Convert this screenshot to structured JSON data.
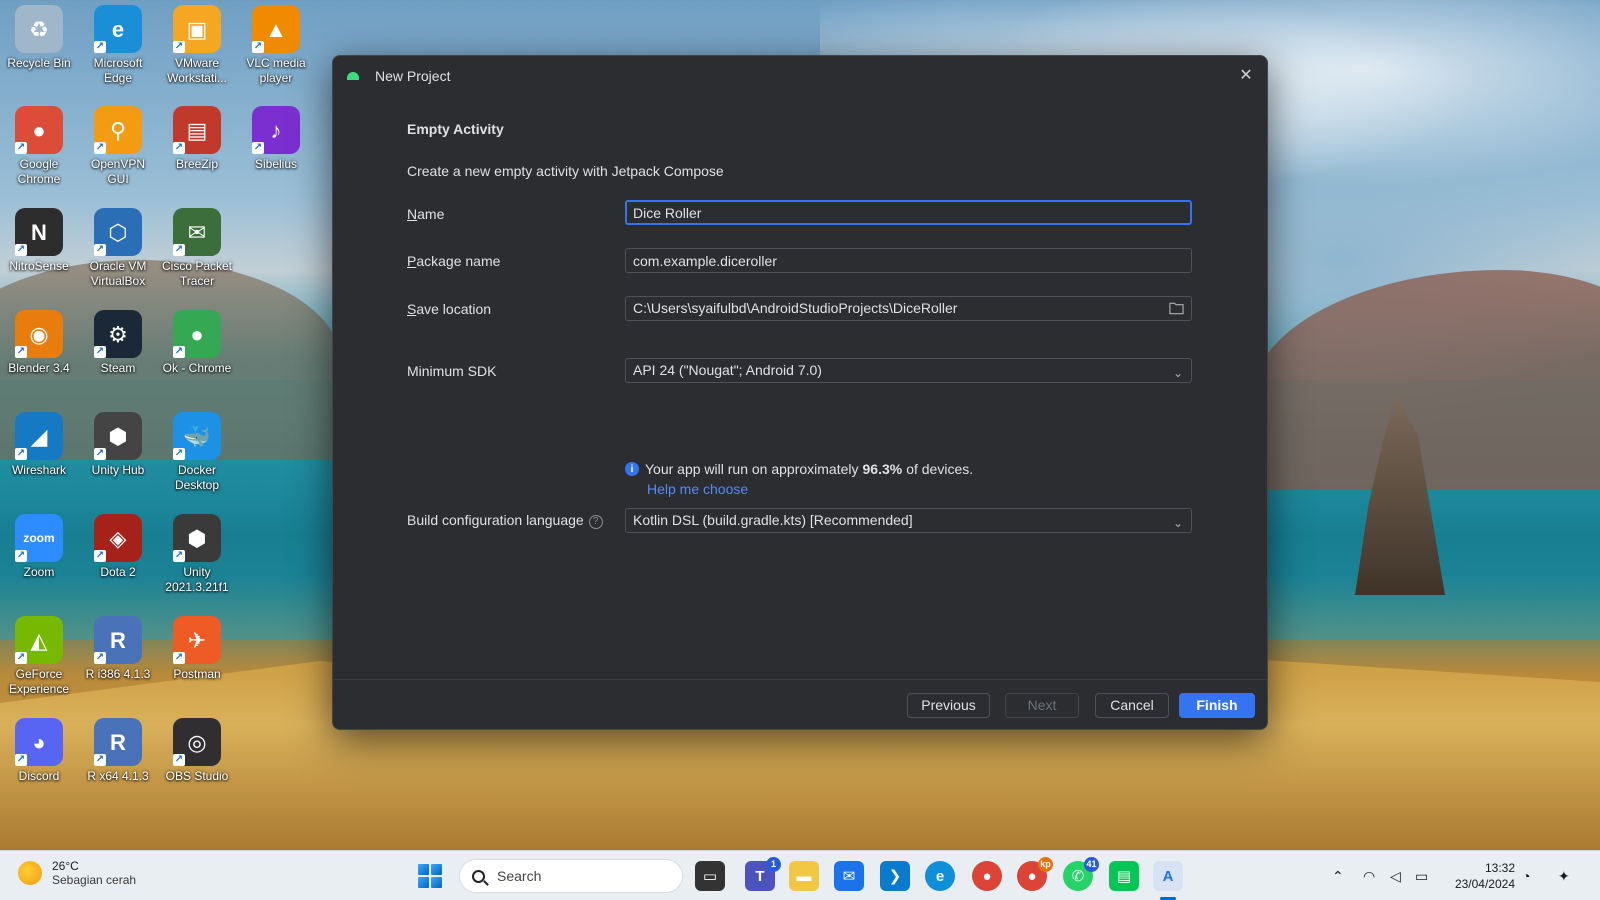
{
  "desktop_icons": [
    {
      "label": "Recycle Bin",
      "glyph": "♻",
      "color": "#9fb7c9"
    },
    {
      "label": "Microsoft Edge",
      "glyph": "e",
      "color": "#1a8fd8"
    },
    {
      "label": "VMware Workstati...",
      "glyph": "▣",
      "color": "#f5a623"
    },
    {
      "label": "VLC media player",
      "glyph": "▲",
      "color": "#f08a00"
    },
    {
      "label": "Google Chrome",
      "glyph": "●",
      "color": "#dd4b39"
    },
    {
      "label": "OpenVPN GUI",
      "glyph": "⚲",
      "color": "#f39c12"
    },
    {
      "label": "BreeZip",
      "glyph": "▤",
      "color": "#c0392b"
    },
    {
      "label": "Sibelius",
      "glyph": "♪",
      "color": "#7b2fd1"
    },
    {
      "label": "NitroSense",
      "glyph": "N",
      "color": "#2d2d2d"
    },
    {
      "label": "Oracle VM VirtualBox",
      "glyph": "⬡",
      "color": "#2a6fb5"
    },
    {
      "label": "Cisco Packet Tracer",
      "glyph": "✉",
      "color": "#3b6e3b"
    },
    {
      "label": "Blender 3.4",
      "glyph": "◉",
      "color": "#e87d0d"
    },
    {
      "label": "Steam",
      "glyph": "⚙",
      "color": "#1b2838"
    },
    {
      "label": "Ok - Chrome",
      "glyph": "●",
      "color": "#34a853"
    },
    {
      "label": "Wireshark",
      "glyph": "◢",
      "color": "#1679c4"
    },
    {
      "label": "Unity Hub",
      "glyph": "⬢",
      "color": "#444444"
    },
    {
      "label": "Docker Desktop",
      "glyph": "🐳",
      "color": "#1d91e6"
    },
    {
      "label": "Zoom",
      "glyph": "zoom",
      "color": "#2d8cff"
    },
    {
      "label": "Dota 2",
      "glyph": "◈",
      "color": "#a7211b"
    },
    {
      "label": "Unity 2021.3.21f1",
      "glyph": "⬢",
      "color": "#3a3a3a"
    },
    {
      "label": "GeForce Experience",
      "glyph": "◭",
      "color": "#76b900"
    },
    {
      "label": "R i386 4.1.3",
      "glyph": "R",
      "color": "#4a72b8"
    },
    {
      "label": "Postman",
      "glyph": "✈",
      "color": "#ef5b25"
    },
    {
      "label": "Discord",
      "glyph": "◕",
      "color": "#5865f2"
    },
    {
      "label": "R x64 4.1.3",
      "glyph": "R",
      "color": "#4a72b8"
    },
    {
      "label": "OBS Studio",
      "glyph": "◎",
      "color": "#302e31"
    }
  ],
  "dialog": {
    "title": "New Project",
    "section_title": "Empty Activity",
    "description": "Create a new empty activity with Jetpack Compose",
    "name_label_mnemonic": "N",
    "name_label_rest": "ame",
    "name_value": "Dice Roller",
    "package_label_mnemonic": "P",
    "package_label_rest": "ackage name",
    "package_value": "com.example.diceroller",
    "save_label_mnemonic": "S",
    "save_label_rest": "ave location",
    "save_value": "C:\\Users\\syaifulbd\\AndroidStudioProjects\\DiceRoller",
    "min_sdk_label": "Minimum SDK",
    "min_sdk_value": "API 24 (\"Nougat\"; Android 7.0)",
    "info_prefix": "Your app will run on approximately ",
    "info_percent": "96.3%",
    "info_suffix": " of devices.",
    "help_link": "Help me choose",
    "build_label": "Build configuration language",
    "build_value": "Kotlin DSL (build.gradle.kts) [Recommended]",
    "buttons": {
      "previous": "Previous",
      "next": "Next",
      "cancel": "Cancel",
      "finish": "Finish"
    },
    "accent_color": "#3574f0"
  },
  "taskbar": {
    "weather_temp": "26°C",
    "weather_desc": "Sebagian cerah",
    "search_placeholder": "Search",
    "badges": {
      "teams": "1",
      "whatsapp": "41",
      "chrome": "kp"
    },
    "time": "13:32",
    "date": "23/04/2024"
  }
}
